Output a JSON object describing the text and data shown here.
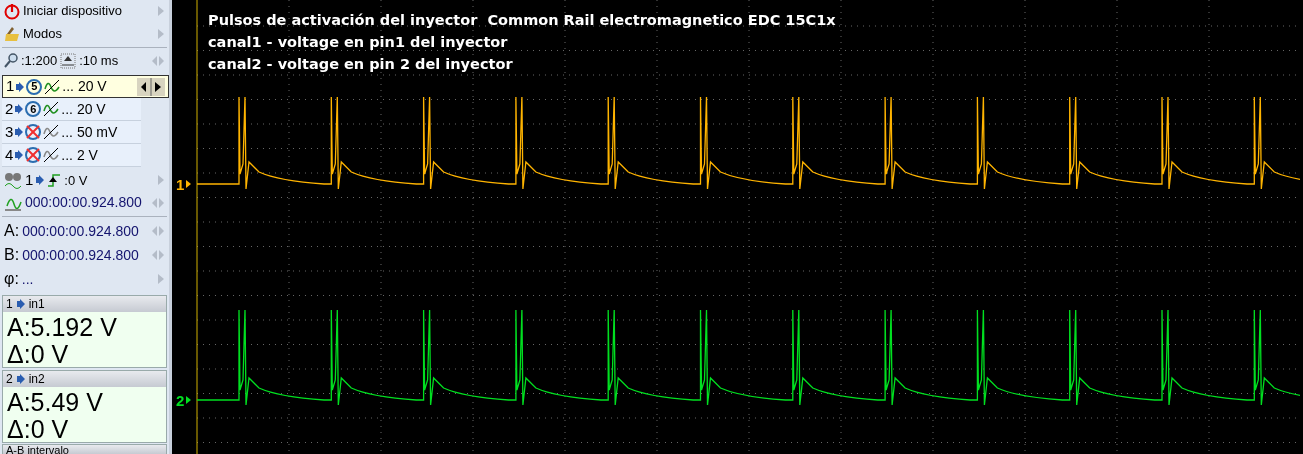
{
  "menu": [
    {
      "kind": "power",
      "label": "Iniciar dispositivo"
    },
    {
      "kind": "modes",
      "label": "Modos"
    }
  ],
  "zoom": {
    "ratio": ":1:200",
    "timebase": ":10 ms"
  },
  "channels": [
    {
      "number": "1",
      "probe": "5",
      "enabled": true,
      "scale": "... 20 V",
      "selected": true
    },
    {
      "number": "2",
      "probe": "6",
      "enabled": true,
      "scale": "... 20 V",
      "selected": false
    },
    {
      "number": "3",
      "enabled": false,
      "scale": "... 50 mV",
      "selected": false
    },
    {
      "number": "4",
      "enabled": false,
      "scale": "... 2 V",
      "selected": false
    }
  ],
  "trigger": {
    "channel": "1",
    "level": ":0 V"
  },
  "trigger_time": "000:00:00.924.800",
  "cursors": [
    {
      "label": "A:",
      "time": "000:00:00.924.800"
    },
    {
      "label": "B:",
      "time": "000:00:00.924.800"
    }
  ],
  "phase": {
    "label": "φ:",
    "value": "..."
  },
  "readouts": [
    {
      "channel": "1",
      "title": "in1",
      "a": "A:5.192 V",
      "delta": "Δ:0 V"
    },
    {
      "channel": "2",
      "title": "in2",
      "a": "A:5.49 V",
      "delta": "Δ:0 V"
    }
  ],
  "interval_panel": {
    "title": "A-B intervalo"
  },
  "scope": {
    "notes": [
      "Pulsos de activación del inyector  Common Rail electromagnetico EDC 15C1x",
      "canal1 - voltage en pin1 del inyector",
      "canal2 - voltage en pin 2 del inyector"
    ],
    "traces": [
      {
        "label": "1",
        "color": "#ffb400"
      },
      {
        "label": "2",
        "color": "#00e020"
      }
    ]
  }
}
